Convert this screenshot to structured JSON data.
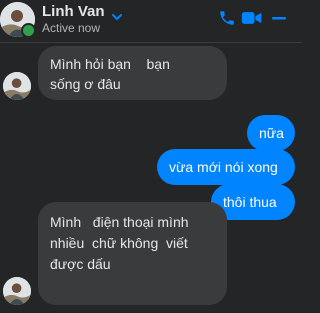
{
  "contact": {
    "name": "Linh Van",
    "status": "Active now"
  },
  "header_icons": [
    "chevron-down-icon",
    "phone-icon",
    "video-icon",
    "minimize-icon"
  ],
  "colors": {
    "background": "#242526",
    "incoming_bubble": "#3a3b3c",
    "outgoing_bubble": "#0084ff",
    "accent": "#0084ff",
    "online": "#31a24c"
  },
  "messages": [
    {
      "direction": "incoming",
      "text": "Mình hỏi bạn    bạn\nsống ơ đâu"
    },
    {
      "direction": "outgoing",
      "text": "nữa"
    },
    {
      "direction": "outgoing",
      "text": "vừa mới nói xong"
    },
    {
      "direction": "outgoing",
      "text": "thôi thua"
    },
    {
      "direction": "incoming",
      "text": "Mình   điện thoại mình\nnhiều  chữ không  viết\nđược dấu"
    }
  ]
}
